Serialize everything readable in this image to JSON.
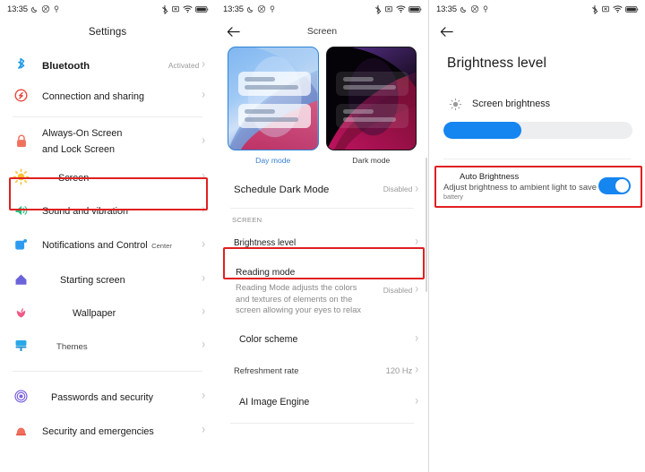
{
  "statusbar": {
    "time": "13:35",
    "left_icons": [
      "moon-icon",
      "do-not-disturb-icon",
      "location-icon"
    ],
    "right_icons": [
      "bluetooth-icon",
      "sim-icon",
      "wifi-icon",
      "battery-icon"
    ],
    "battery_text": "98"
  },
  "panel1": {
    "title": "Settings",
    "items": [
      {
        "label": "Bluetooth",
        "value": "Activated",
        "icon": "bluetooth-icon",
        "bold": true
      },
      {
        "label": "Connection and sharing",
        "value": "",
        "icon": "connection-sharing-icon",
        "bold": false
      },
      {
        "label": "Always-On Screen",
        "sub": "and Lock Screen",
        "value": "",
        "icon": "lock-icon",
        "bold": false
      },
      {
        "label": "Screen",
        "value": "",
        "icon": "brightness-sun-icon",
        "bold": false,
        "highlighted": true
      },
      {
        "label": "Sound and vibration",
        "value": "",
        "icon": "speaker-icon",
        "bold": false
      },
      {
        "label": "Notifications and Control",
        "sub": "Center",
        "value": "",
        "icon": "notifications-icon",
        "bold": false
      },
      {
        "label": "Starting screen",
        "value": "",
        "icon": "home-icon",
        "bold": false
      },
      {
        "label": "Wallpaper",
        "value": "",
        "icon": "wallpaper-flower-icon",
        "bold": false
      },
      {
        "label": "Themes",
        "value": "",
        "icon": "themes-brush-icon",
        "bold": false
      },
      {
        "label": "Passwords and security",
        "value": "",
        "icon": "fingerprint-icon",
        "bold": false
      },
      {
        "label": "Security and emergencies",
        "value": "",
        "icon": "emergency-bell-icon",
        "bold": false
      }
    ]
  },
  "panel2": {
    "title": "Screen",
    "back": "back-arrow-icon",
    "modes": [
      {
        "label": "Day mode",
        "selected": true
      },
      {
        "label": "Dark mode",
        "selected": false
      }
    ],
    "schedule": {
      "label": "Schedule Dark Mode",
      "value": "Disabled"
    },
    "section_header": "SCREEN",
    "brightness": {
      "label": "Brightness level",
      "value": "",
      "highlighted": true
    },
    "reading": {
      "label": "Reading mode",
      "desc": "Reading Mode adjusts the colors and textures of elements on the screen allowing your eyes to relax",
      "value": "Disabled"
    },
    "items": [
      {
        "label": "Color scheme",
        "value": ""
      },
      {
        "label": "Refreshment rate",
        "value": "120 Hz"
      },
      {
        "label": "AI Image Engine",
        "value": ""
      }
    ]
  },
  "panel3": {
    "back": "back-arrow-icon",
    "title": "Brightness level",
    "screen_brightness": {
      "label": "Screen brightness",
      "icon": "brightness-sun-icon",
      "percent": 41
    },
    "auto_brightness": {
      "title": "Auto Brightness",
      "desc": "Adjust brightness to ambient light to save",
      "desc2": "battery",
      "toggle_on": true,
      "highlighted": true
    }
  },
  "colors": {
    "accent_blue": "#1585f0",
    "highlight_red": "#e02020",
    "muted_gray": "#9a9a9a"
  }
}
